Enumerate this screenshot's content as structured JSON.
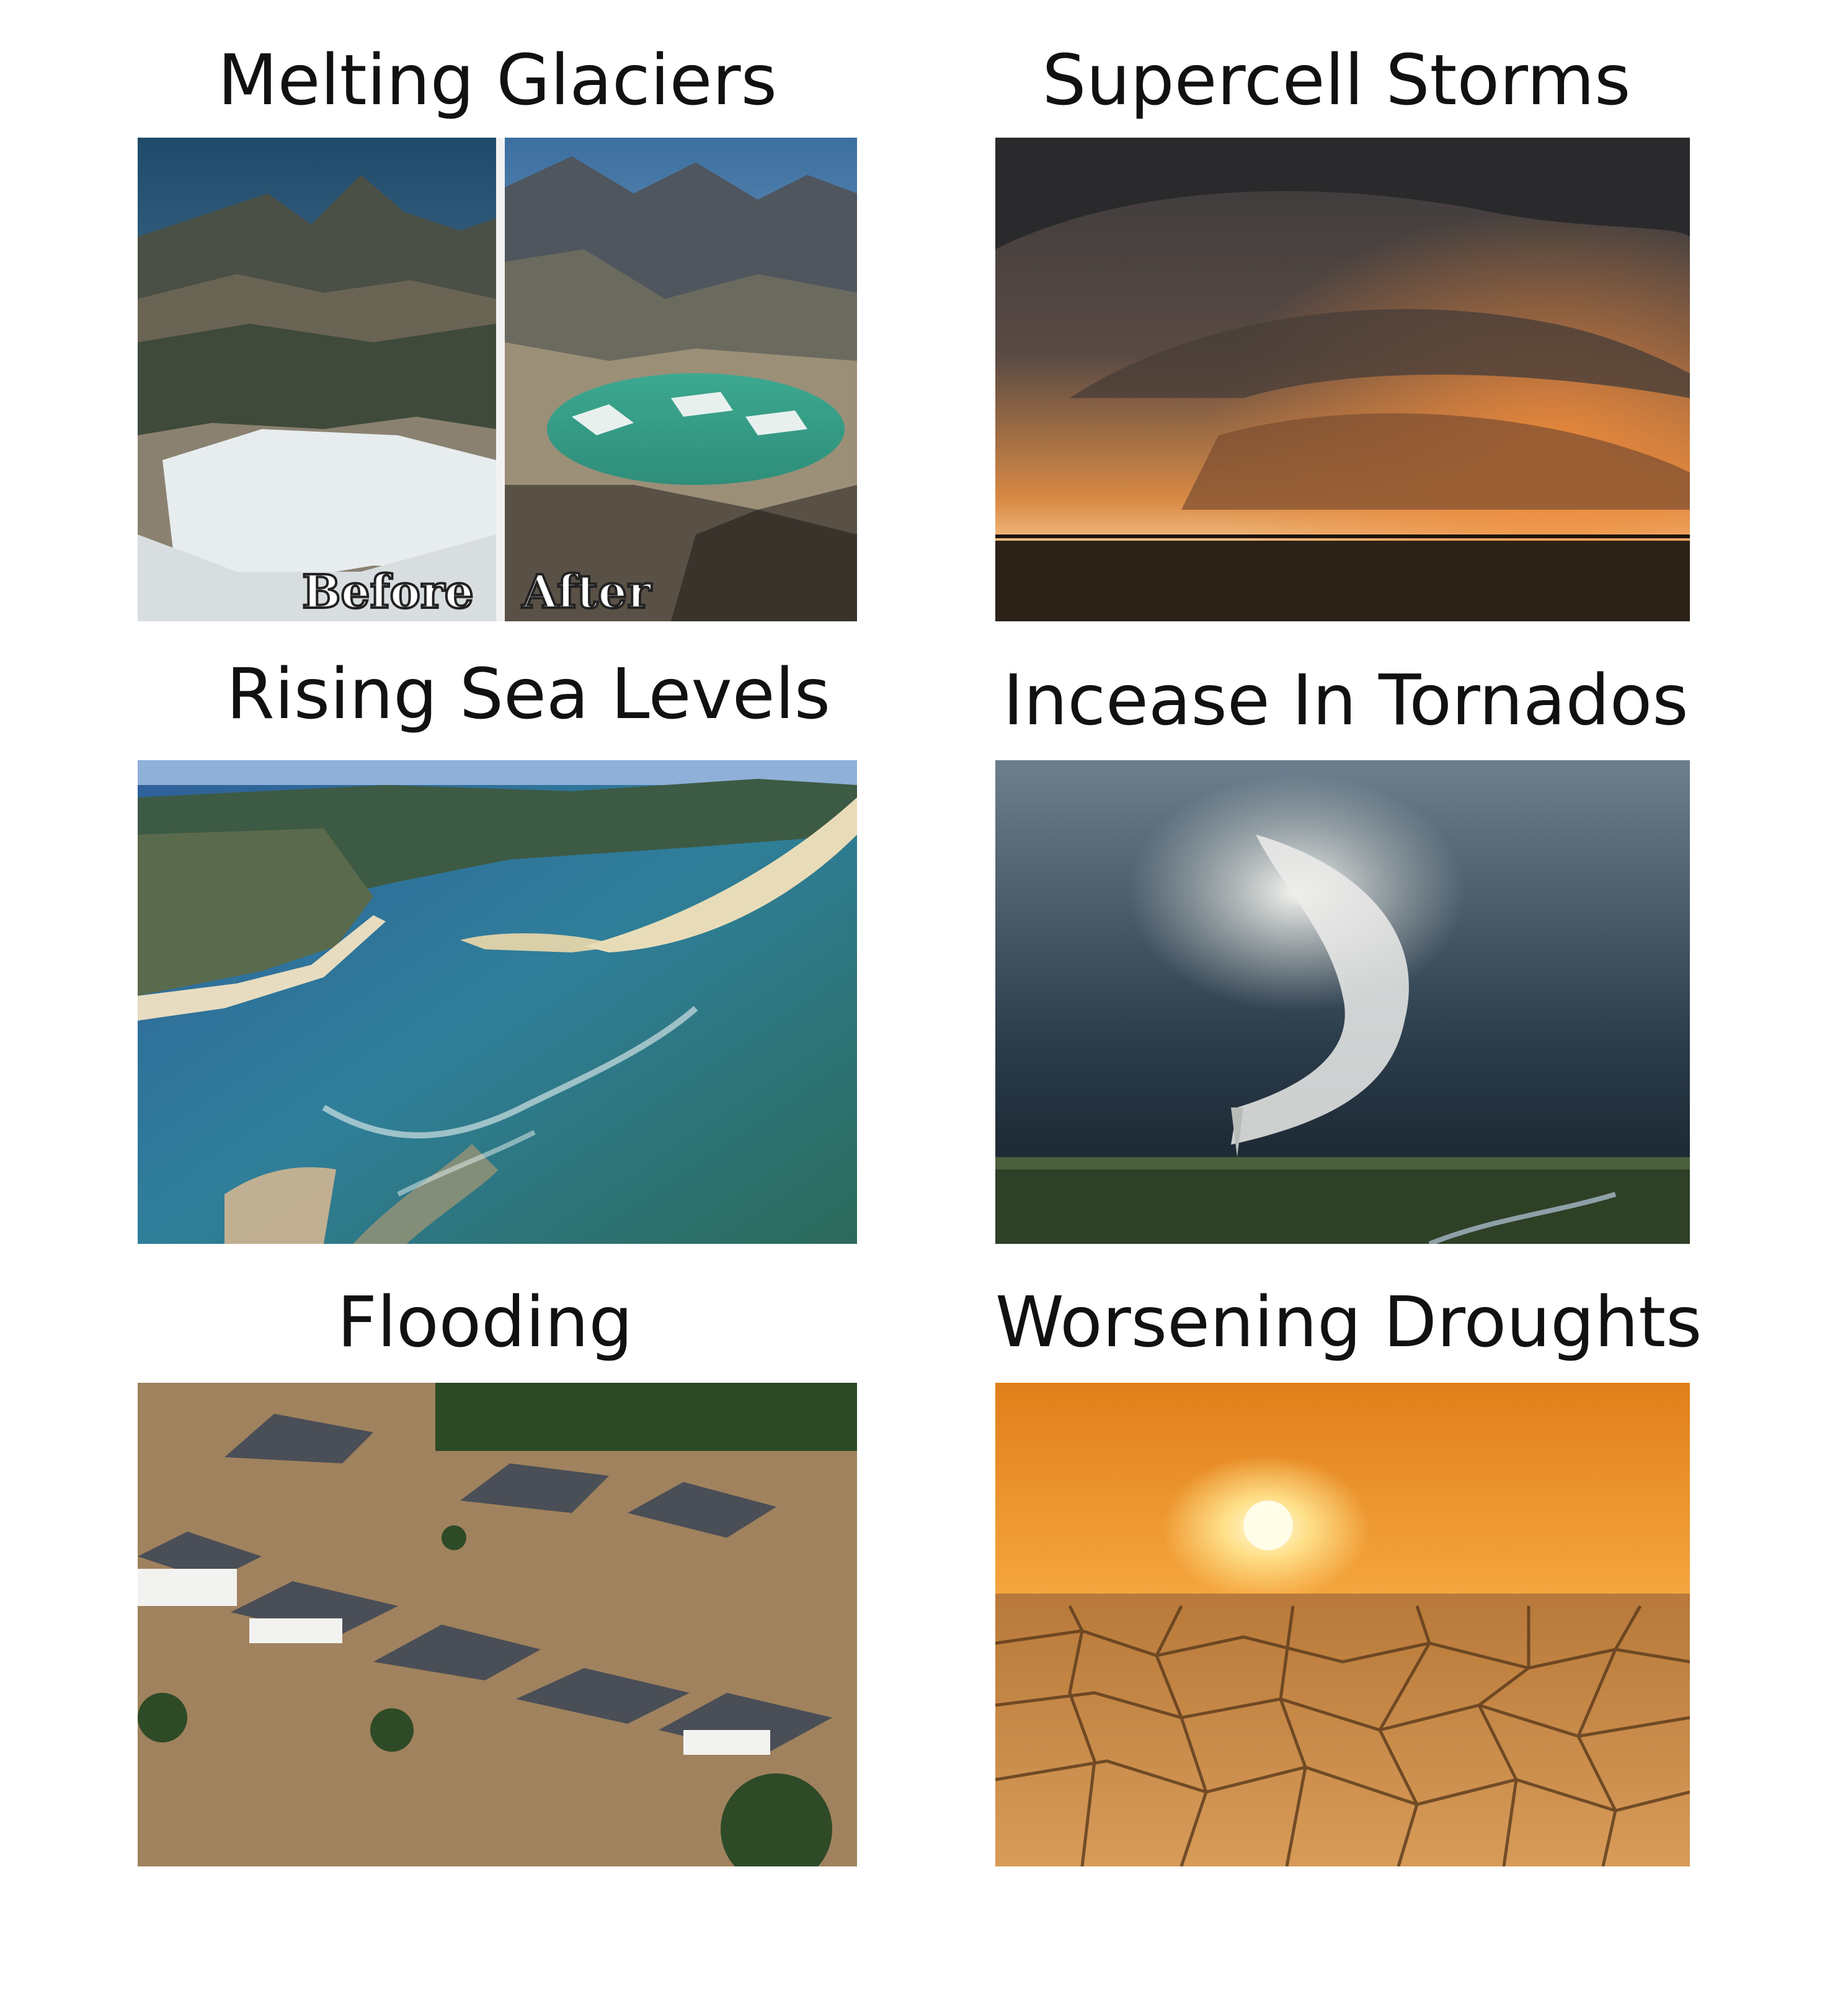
{
  "panels": [
    {
      "caption": "Melting Glaciers",
      "image": "glacier-before-after-photo",
      "overlay": {
        "before": "Before",
        "after": "After"
      }
    },
    {
      "caption": "Supercell Storms",
      "image": "supercell-storm-photo"
    },
    {
      "caption": "Rising Sea Levels",
      "image": "coastline-aerial-photo"
    },
    {
      "caption": "Incease In Tornados",
      "image": "tornado-photo"
    },
    {
      "caption": "Flooding",
      "image": "flooded-houses-photo"
    },
    {
      "caption": "Worsening Droughts",
      "image": "drought-cracked-earth-photo"
    }
  ]
}
